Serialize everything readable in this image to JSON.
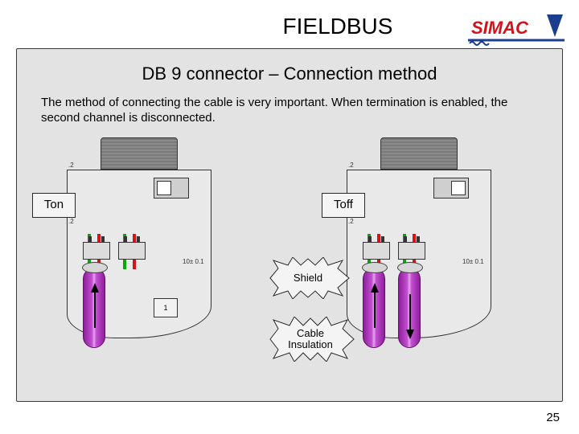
{
  "title": "FIELDBUS",
  "logo": {
    "text": "SIMAC",
    "brand_red": "#d3121a",
    "brand_blue": "#1d3e8f"
  },
  "subtitle": "DB 9 connector – Connection method",
  "body": "The method of connecting the cable is very important. When termination is enabled, the second channel is disconnected.",
  "callouts": {
    "ton": "Ton",
    "toff": "Toff",
    "shield": "Shield",
    "cable_insulation": "Cable\nInsulation"
  },
  "diagram": {
    "dim_small": ".2",
    "dim_right": "10± 0.1",
    "mini_box": "1"
  },
  "page_number": "25"
}
